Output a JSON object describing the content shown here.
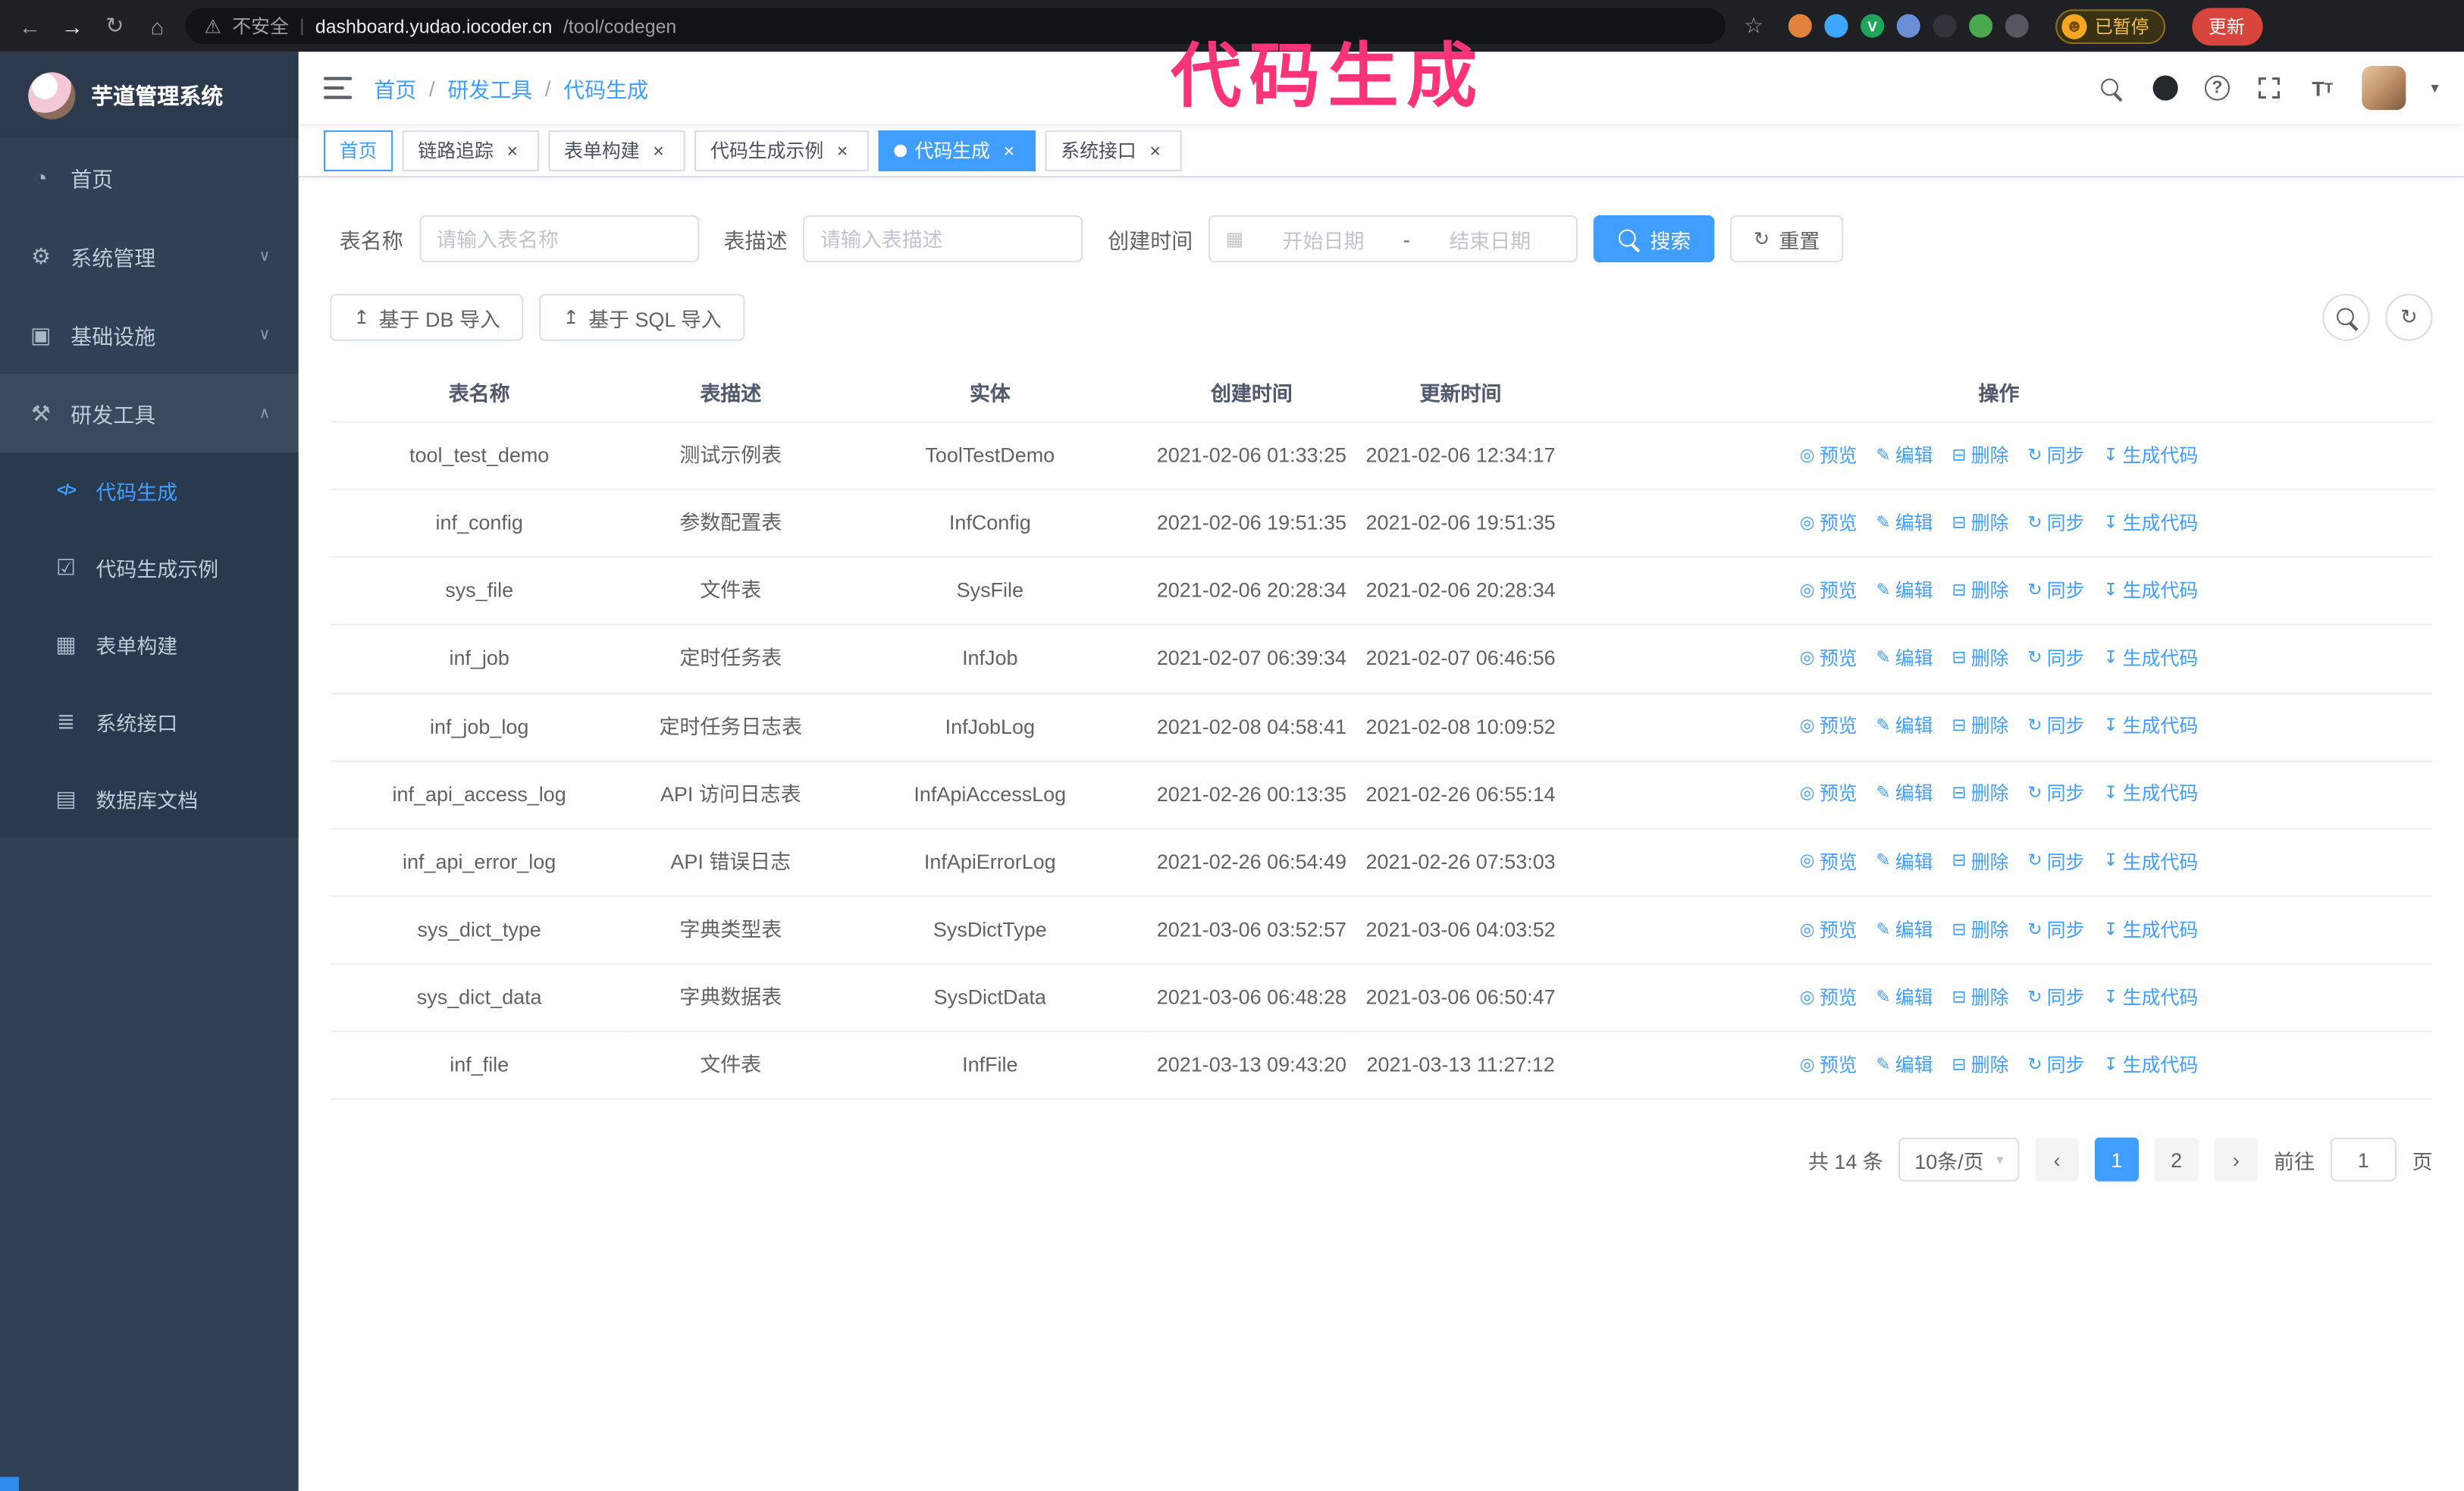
{
  "colors": {
    "accent": "#409eff",
    "sidebar_bg": "#304156",
    "chrome_bg": "#1e2023",
    "annotation": "#fb3379"
  },
  "annotation": {
    "text": "代码生成"
  },
  "browser": {
    "security_label": "不安全",
    "host": "dashboard.yudao.iocoder.cn",
    "path": "/tool/codegen",
    "profile_badge": "已暂停",
    "update_button": "更新",
    "extensions": [
      {
        "name": "fox-extension",
        "color": "#e0823d"
      },
      {
        "name": "drop-extension",
        "color": "#3ea6ff"
      },
      {
        "name": "check-extension",
        "color": "#1fa45c",
        "glyph": "V"
      },
      {
        "name": "people-extension",
        "color": "#6b8fd7"
      },
      {
        "name": "capture-extension",
        "color": "#30343a"
      },
      {
        "name": "leaf-extension",
        "color": "#4aa94e"
      },
      {
        "name": "puzzle-extension",
        "color": "#54585e"
      }
    ]
  },
  "sidebar": {
    "logo_title": "芋道管理系统",
    "items": [
      {
        "label": "首页"
      },
      {
        "label": "系统管理"
      },
      {
        "label": "基础设施"
      },
      {
        "label": "研发工具"
      }
    ],
    "subitems": [
      {
        "label": "代码生成"
      },
      {
        "label": "代码生成示例"
      },
      {
        "label": "表单构建"
      },
      {
        "label": "系统接口"
      },
      {
        "label": "数据库文档"
      }
    ]
  },
  "header": {
    "breadcrumb": [
      "首页",
      "研发工具",
      "代码生成"
    ]
  },
  "tabs": [
    {
      "label": "首页",
      "closable": false
    },
    {
      "label": "链路追踪",
      "closable": true
    },
    {
      "label": "表单构建",
      "closable": true
    },
    {
      "label": "代码生成示例",
      "closable": true
    },
    {
      "label": "代码生成",
      "closable": true,
      "active": true
    },
    {
      "label": "系统接口",
      "closable": true
    }
  ],
  "filters": {
    "table_name_label": "表名称",
    "table_name_placeholder": "请输入表名称",
    "table_desc_label": "表描述",
    "table_desc_placeholder": "请输入表描述",
    "create_time_label": "创建时间",
    "date_start_placeholder": "开始日期",
    "date_separator": "-",
    "date_end_placeholder": "结束日期",
    "search_button": "搜索",
    "reset_button": "重置"
  },
  "toolbar": {
    "import_db": "基于 DB 导入",
    "import_sql": "基于 SQL 导入"
  },
  "table": {
    "columns": [
      "表名称",
      "表描述",
      "实体",
      "创建时间",
      "更新时间",
      "操作"
    ],
    "actions": [
      {
        "key": "preview",
        "label": "预览",
        "icon": "eye",
        "glyph": "◎"
      },
      {
        "key": "edit",
        "label": "编辑",
        "icon": "edit-pencil",
        "glyph": "✎"
      },
      {
        "key": "delete",
        "label": "删除",
        "icon": "trash",
        "glyph": "⊟"
      },
      {
        "key": "sync",
        "label": "同步",
        "icon": "sync",
        "glyph": "↻"
      },
      {
        "key": "generate",
        "label": "生成代码",
        "icon": "download",
        "glyph": "↧"
      }
    ],
    "rows": [
      {
        "name": "tool_test_demo",
        "desc": "测试示例表",
        "entity": "ToolTestDemo",
        "created": "2021-02-06 01:33:25",
        "updated": "2021-02-06 12:34:17"
      },
      {
        "name": "inf_config",
        "desc": "参数配置表",
        "entity": "InfConfig",
        "created": "2021-02-06 19:51:35",
        "updated": "2021-02-06 19:51:35"
      },
      {
        "name": "sys_file",
        "desc": "文件表",
        "entity": "SysFile",
        "created": "2021-02-06 20:28:34",
        "updated": "2021-02-06 20:28:34"
      },
      {
        "name": "inf_job",
        "desc": "定时任务表",
        "entity": "InfJob",
        "created": "2021-02-07 06:39:34",
        "updated": "2021-02-07 06:46:56"
      },
      {
        "name": "inf_job_log",
        "desc": "定时任务日志表",
        "entity": "InfJobLog",
        "created": "2021-02-08 04:58:41",
        "updated": "2021-02-08 10:09:52"
      },
      {
        "name": "inf_api_access_log",
        "desc": "API 访问日志表",
        "entity": "InfApiAccessLog",
        "created": "2021-02-26 00:13:35",
        "updated": "2021-02-26 06:55:14"
      },
      {
        "name": "inf_api_error_log",
        "desc": "API 错误日志",
        "entity": "InfApiErrorLog",
        "created": "2021-02-26 06:54:49",
        "updated": "2021-02-26 07:53:03"
      },
      {
        "name": "sys_dict_type",
        "desc": "字典类型表",
        "entity": "SysDictType",
        "created": "2021-03-06 03:52:57",
        "updated": "2021-03-06 04:03:52"
      },
      {
        "name": "sys_dict_data",
        "desc": "字典数据表",
        "entity": "SysDictData",
        "created": "2021-03-06 06:48:28",
        "updated": "2021-03-06 06:50:47"
      },
      {
        "name": "inf_file",
        "desc": "文件表",
        "entity": "InfFile",
        "created": "2021-03-13 09:43:20",
        "updated": "2021-03-13 11:27:12"
      }
    ]
  },
  "pagination": {
    "total": "共 14 条",
    "page_size": "10条/页",
    "prev": "‹",
    "next": "›",
    "page1": "1",
    "page2": "2",
    "goto_label": "前往",
    "goto_value": "1",
    "goto_unit": "页"
  },
  "icons": {
    "back": "←",
    "forward": "→",
    "reload": "↻",
    "home": "⌂",
    "warning": "⚠",
    "star": "☆",
    "divider": "|",
    "face": "☻",
    "menu_home": "◔",
    "gear": "⚙",
    "infra": "▣",
    "tools": "⚒",
    "codegen": "</>",
    "shield_check": "☑",
    "form": "▦",
    "api": "≣",
    "db": "▤",
    "chevron_down": "∨",
    "chevron_up": "∧",
    "caret_down": "▾",
    "help": "?",
    "upload": "↥",
    "refresh": "↻",
    "calendar": "▦",
    "close": "×"
  }
}
